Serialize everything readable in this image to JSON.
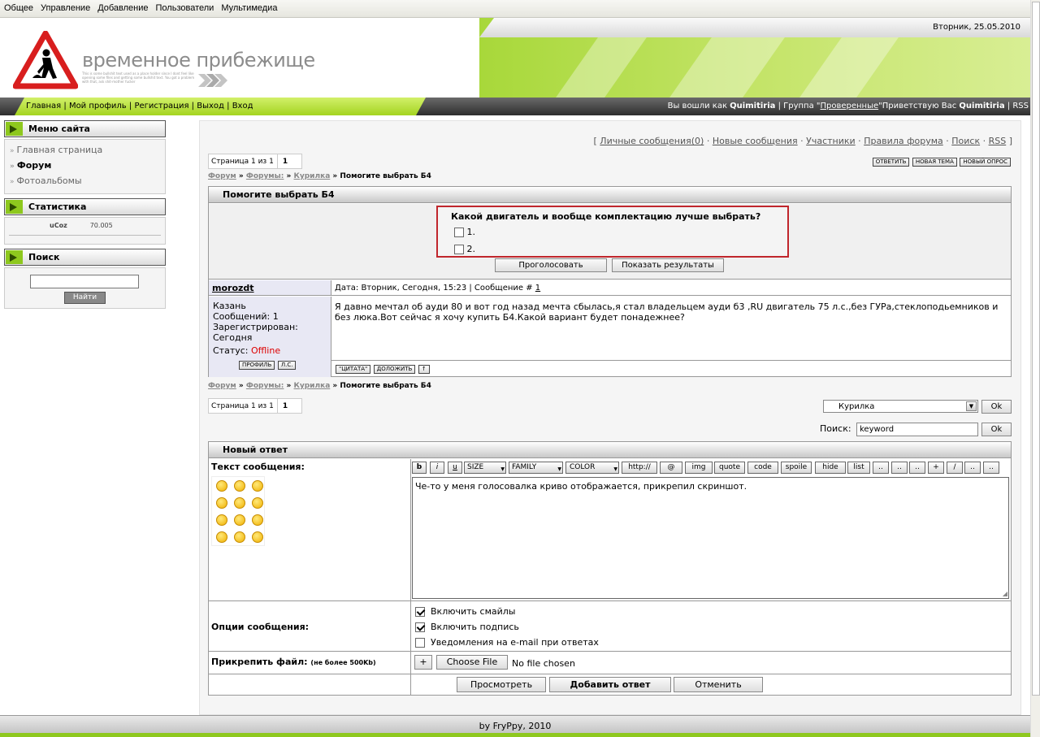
{
  "admin_bar": [
    "Общее",
    "Управление",
    "Добавление",
    "Пользователи",
    "Мультимедиа"
  ],
  "header": {
    "date": "Вторник, 25.05.2010",
    "site_name": "временное прибежище",
    "tiny_text": "This is some bullshit text used as a place holder since I dont feel like opening some files and getting some bullshit text. You got a problem with that, ask shit-mother fucker"
  },
  "nav": {
    "links": [
      "Главная",
      "Мой профиль",
      "Регистрация",
      "Выход",
      "Вход"
    ],
    "logged_prefix": "Вы вошли как",
    "user": "Quimitiria",
    "group_prefix": "Группа \"",
    "group": "Проверенные",
    "greeting_prefix": "\"Приветствую Вас",
    "rss": "RSS"
  },
  "sidebar": {
    "menu_title": "Меню сайта",
    "menu_items": [
      "Главная страница",
      "Форум",
      "Фотоальбомы"
    ],
    "stats_title": "Статистика",
    "counter_text": "uCoz",
    "counter_value": "70.005",
    "search_title": "Поиск",
    "search_button": "Найти"
  },
  "toplinks": [
    "Личные сообщения(0)",
    "Новые сообщения",
    "Участники",
    "Правила форума",
    "Поиск",
    "RSS"
  ],
  "pagination": {
    "text": "Страница 1 из 1",
    "current": "1"
  },
  "actions": [
    "ответить",
    "новая тема",
    "новый опрос"
  ],
  "breadcrumb": {
    "forum": "Форум",
    "forums": "Форумы:",
    "section": "Курилка",
    "topic": "Помогите выбрать Б4",
    "sep": "»"
  },
  "thread": {
    "title": "Помогите выбрать Б4",
    "poll_question": "Какой двигатель и вообще комплектацию лучше выбрать?",
    "poll_options": [
      "1.",
      "2."
    ],
    "vote_button": "Проголосовать",
    "results_button": "Показать результаты"
  },
  "post": {
    "author": "morozdt",
    "meta_prefix": "Дата: Вторник, Сегодня, 15:23 | Сообщение #",
    "post_num": "1",
    "city": "Казань",
    "messages": "Сообщений: 1",
    "registered_label": "Зарегистрирован:",
    "registered": "Сегодня",
    "status_label": "Статус:",
    "status": "Offline",
    "profile_btn": "профиль",
    "pm_btn": "л.с.",
    "body": "Я давно мечтал об ауди 80 и вот год назад мечта сбылась,я стал владельцем ауди б3 ,RU двигатель 75 л.с.,без ГУРа,стеклоподьемников и без люка.Вот сейчас я хочу купить Б4.Какой вариант будет понадежнее?",
    "quote_btn": "\"цитата\"",
    "reply_btn": "доложить",
    "top_btn": "↑"
  },
  "jump": {
    "selected": "Курилка",
    "ok": "Ok",
    "search_label": "Поиск:",
    "search_value": "keyword"
  },
  "reply": {
    "title": "Новый ответ",
    "text_label": "Текст сообщения:",
    "editor_buttons": {
      "b": "b",
      "i": "i",
      "u": "u",
      "size": "SIZE",
      "family": "FAMILY",
      "color": "COLOR",
      "http": "http://",
      "at": "@",
      "img": "img",
      "quote": "quote",
      "code": "code",
      "spoiler": "spoile",
      "hide": "hide",
      "list": "list",
      "plus": "+",
      "slash": "/"
    },
    "message": "Че-то у меня голосовалка криво отображается, прикрепил скриншот.",
    "options_label": "Опции сообщения:",
    "options": [
      "Включить смайлы",
      "Включить подпись",
      "Уведомления на e-mail при ответах"
    ],
    "attach_label": "Прикрепить файл:",
    "attach_note": "(не более 500Kb)",
    "attach_plus": "+",
    "choose_file": "Choose File",
    "no_file": "No file chosen",
    "preview": "Просмотреть",
    "submit": "Добавить ответ",
    "cancel": "Отменить"
  },
  "footer": "by FryPpy, 2010"
}
